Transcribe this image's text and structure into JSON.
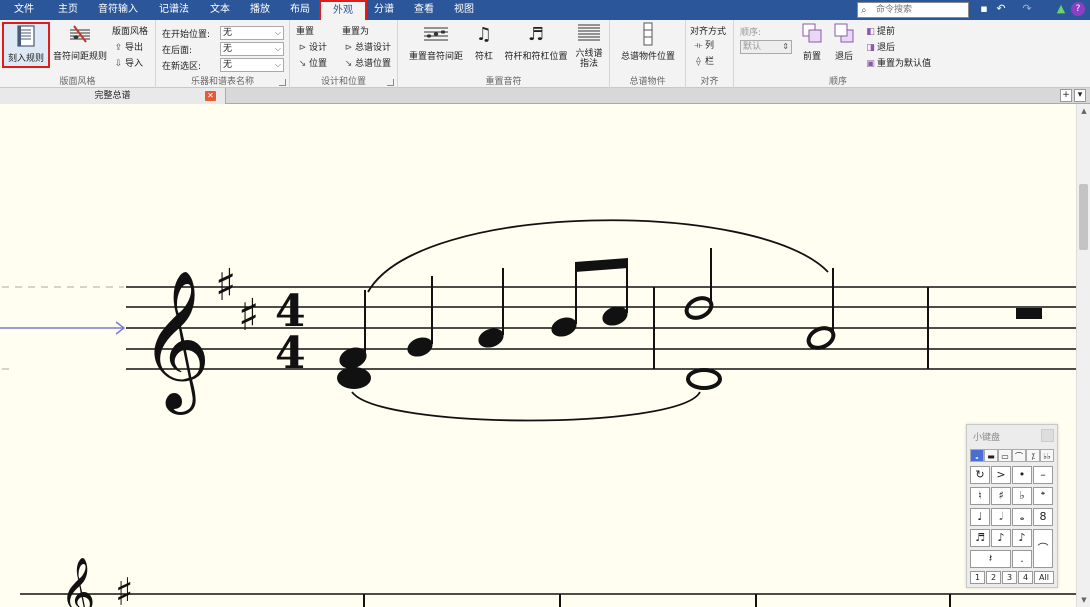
{
  "menubar": {
    "items": [
      "文件",
      "主页",
      "音符输入",
      "记谱法",
      "文本",
      "播放",
      "布局",
      "外观",
      "分谱",
      "查看",
      "视图"
    ],
    "active": "外观",
    "search_placeholder": "命令搜索"
  },
  "ribbon": {
    "house_style": {
      "engraving_rules": "刻入规则",
      "note_spacing_rules": "音符间距规则",
      "house_style_label": "版面风格",
      "export": "导出",
      "import": "导入",
      "group_label": "版面风格"
    },
    "instruments": {
      "at_start_label": "在开始位置:",
      "at_start_value": "无",
      "subsequently_label": "在后面:",
      "subsequently_value": "无",
      "new_section_label": "在新选区:",
      "new_section_value": "无",
      "group_label": "乐器和谱表名称"
    },
    "design": {
      "reset": "重置",
      "reset_as": "重置为",
      "design": "设计",
      "score_design": "总谱设计",
      "position": "位置",
      "score_position": "总谱位置",
      "group_label": "设计和位置"
    },
    "reset_notes": {
      "reset_spacing": "重置音符间距",
      "beams": "符杠",
      "stems_beams_pos": "符杆和符杠位置",
      "tab_fingering": "六线谱指法",
      "group_label": "重置音符"
    },
    "score_objects": {
      "score_object_position": "总谱物件位置",
      "group_label": "总谱物件"
    },
    "align": {
      "align_mode": "对齐方式",
      "column": "列",
      "row": "栏",
      "group_label": "对齐"
    },
    "order": {
      "order_label": "顺序:",
      "order_value": "默认",
      "bring_front": "前置",
      "send_back": "退后",
      "bring_forward": "提前",
      "send_backward": "退后",
      "reset_default": "重置为默认值",
      "group_label": "顺序"
    }
  },
  "tabstrip": {
    "doc_tab": "完整总谱",
    "add": "+",
    "menu": "▾"
  },
  "score": {
    "clef": "treble",
    "key_signature": "D major (2 sharps)",
    "time_signature": {
      "numerator": "4",
      "denominator": "4"
    }
  },
  "keypad": {
    "title": "小键盘",
    "tabs": [
      "𝅝",
      "▬",
      "▭",
      "⌒",
      "⁒",
      "♭♭"
    ],
    "rows": [
      [
        "↻",
        ">",
        "•",
        "–"
      ],
      [
        "♮",
        "♯",
        "♭",
        "𝄌"
      ],
      [
        "♩",
        "𝅗𝅥",
        "𝅝",
        "8"
      ],
      [
        "♬",
        "♪",
        "♪",
        "⌒"
      ],
      [
        "𝄽",
        ".",
        "",
        ""
      ]
    ],
    "layers": [
      "1",
      "2",
      "3",
      "4",
      "All"
    ]
  }
}
